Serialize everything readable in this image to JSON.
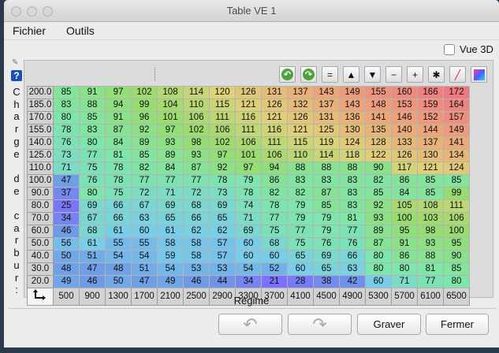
{
  "window": {
    "title": "Table VE 1"
  },
  "menu": {
    "items": [
      "Fichier",
      "Outils"
    ]
  },
  "options": {
    "vue3d_label": "Vue 3D",
    "vue3d_checked": false
  },
  "y_axis": {
    "label": [
      "C",
      "h",
      "a",
      "r",
      "g",
      "e",
      "",
      "d",
      "e",
      "",
      "c",
      "a",
      "r",
      "b",
      "u",
      "r",
      ":"
    ]
  },
  "x_axis": {
    "label": "Régime"
  },
  "toolbar": {
    "buttons": [
      {
        "name": "undo-table-button",
        "icon": "green-rotate-left-icon",
        "glyph": "↶",
        "color": "#4fa23a"
      },
      {
        "name": "redo-table-button",
        "icon": "green-rotate-right-icon",
        "glyph": "↷",
        "color": "#4fa23a"
      },
      {
        "name": "set-equal-button",
        "icon": "equals-icon",
        "glyph": "="
      },
      {
        "name": "increment-button",
        "icon": "triangle-up-icon",
        "glyph": "▲"
      },
      {
        "name": "decrement-button",
        "icon": "triangle-down-icon",
        "glyph": "▼"
      },
      {
        "name": "subtract-button",
        "icon": "minus-icon",
        "glyph": "−"
      },
      {
        "name": "add-button",
        "icon": "plus-icon",
        "glyph": "+"
      },
      {
        "name": "multiply-button",
        "icon": "asterisk-icon",
        "glyph": "✱"
      },
      {
        "name": "interpolate-button",
        "icon": "color-pencil-icon",
        "glyph": "╱",
        "color": "#2234b8"
      },
      {
        "name": "color-map-button",
        "icon": "gradient-icon",
        "glyph": ""
      }
    ]
  },
  "table": {
    "rows_label": [
      "200.0",
      "185.0",
      "170.0",
      "155.0",
      "140.0",
      "125.0",
      "110.0",
      "100.0",
      "90.0",
      "80.0",
      "70.0",
      "60.0",
      "50.0",
      "40.0",
      "30.0",
      "20.0"
    ],
    "cols_label": [
      "500",
      "900",
      "1300",
      "1700",
      "2100",
      "2500",
      "2900",
      "3300",
      "3700",
      "4100",
      "4500",
      "4900",
      "5300",
      "5700",
      "6100",
      "6500"
    ],
    "values": [
      [
        85,
        91,
        97,
        102,
        108,
        114,
        120,
        126,
        131,
        137,
        143,
        149,
        155,
        160,
        166,
        172
      ],
      [
        83,
        88,
        94,
        99,
        104,
        110,
        115,
        121,
        126,
        132,
        137,
        143,
        148,
        153,
        159,
        164
      ],
      [
        80,
        85,
        91,
        96,
        101,
        106,
        111,
        116,
        121,
        126,
        131,
        136,
        141,
        146,
        152,
        157
      ],
      [
        78,
        83,
        87,
        92,
        97,
        102,
        106,
        111,
        116,
        121,
        125,
        130,
        135,
        140,
        144,
        149
      ],
      [
        76,
        80,
        84,
        89,
        93,
        98,
        102,
        106,
        111,
        115,
        119,
        124,
        128,
        133,
        137,
        141
      ],
      [
        73,
        77,
        81,
        85,
        89,
        93,
        97,
        101,
        106,
        110,
        114,
        118,
        122,
        126,
        130,
        134
      ],
      [
        71,
        75,
        78,
        82,
        84,
        87,
        92,
        97,
        94,
        88,
        88,
        88,
        90,
        117,
        121,
        124
      ],
      [
        47,
        76,
        78,
        77,
        77,
        77,
        78,
        79,
        86,
        83,
        83,
        83,
        82,
        86,
        85,
        85
      ],
      [
        37,
        80,
        75,
        72,
        71,
        72,
        73,
        78,
        82,
        82,
        87,
        83,
        85,
        84,
        85,
        99
      ],
      [
        25,
        69,
        66,
        67,
        69,
        68,
        69,
        74,
        78,
        79,
        85,
        83,
        92,
        105,
        108,
        111
      ],
      [
        34,
        67,
        66,
        63,
        65,
        66,
        65,
        71,
        77,
        79,
        79,
        81,
        93,
        100,
        103,
        106
      ],
      [
        46,
        68,
        61,
        60,
        61,
        62,
        62,
        69,
        75,
        77,
        79,
        77,
        89,
        95,
        98,
        100
      ],
      [
        56,
        61,
        55,
        55,
        58,
        58,
        57,
        60,
        68,
        75,
        76,
        76,
        87,
        91,
        93,
        95
      ],
      [
        50,
        51,
        54,
        54,
        59,
        58,
        57,
        60,
        60,
        65,
        69,
        66,
        80,
        86,
        88,
        90
      ],
      [
        48,
        47,
        48,
        51,
        54,
        53,
        53,
        54,
        52,
        60,
        65,
        63,
        80,
        80,
        81,
        85
      ],
      [
        49,
        46,
        50,
        47,
        49,
        46,
        44,
        34,
        21,
        28,
        38,
        42,
        60,
        71,
        77,
        80
      ]
    ]
  },
  "buttons": {
    "undo_label": "",
    "redo_label": "",
    "save_label": "Graver",
    "close_label": "Fermer"
  }
}
